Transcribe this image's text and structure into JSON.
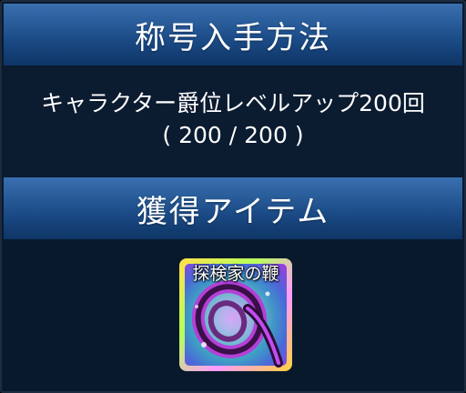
{
  "title_section": {
    "heading": "称号入手方法"
  },
  "method": {
    "description": "キャラクター爵位レベルアップ200回",
    "progress": "( 200 / 200 )"
  },
  "reward_section": {
    "heading": "獲得アイテム"
  },
  "reward_item": {
    "name": "探検家の鞭",
    "icon": "whip-icon"
  }
}
